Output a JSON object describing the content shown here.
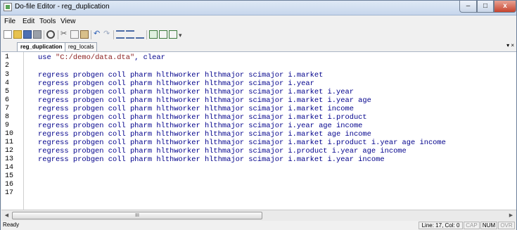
{
  "window": {
    "title": "Do-file Editor - reg_duplication"
  },
  "menu": [
    "File",
    "Edit",
    "Tools",
    "View"
  ],
  "toolbar_icons": [
    "new-file-icon",
    "open-icon",
    "save-icon",
    "print-icon",
    "find-icon",
    "cut-icon",
    "copy-icon",
    "paste-icon",
    "undo-icon",
    "redo-icon",
    "indent-icon",
    "unindent-icon",
    "comment-icon",
    "execute-icon",
    "execute-quietly-icon",
    "execute-selection-icon",
    "dropdown-icon"
  ],
  "tabs": [
    {
      "label": "reg_duplication",
      "active": true
    },
    {
      "label": "reg_locals",
      "active": false
    }
  ],
  "editor": {
    "lines": [
      {
        "num": "1",
        "text": "use ",
        "str": "\"C:/demo/data.dta\"",
        "rest": ", clear"
      },
      {
        "num": "2",
        "text": ""
      },
      {
        "num": "3",
        "text": "regress probgen coll pharm hlthworker hlthmajor scimajor i.market"
      },
      {
        "num": "4",
        "text": "regress probgen coll pharm hlthworker hlthmajor scimajor i.year"
      },
      {
        "num": "5",
        "text": "regress probgen coll pharm hlthworker hlthmajor scimajor i.market i.year"
      },
      {
        "num": "6",
        "text": "regress probgen coll pharm hlthworker hlthmajor scimajor i.market i.year age"
      },
      {
        "num": "7",
        "text": "regress probgen coll pharm hlthworker hlthmajor scimajor i.market income"
      },
      {
        "num": "8",
        "text": "regress probgen coll pharm hlthworker hlthmajor scimajor i.market i.product"
      },
      {
        "num": "9",
        "text": "regress probgen coll pharm hlthworker hlthmajor scimajor i.year age income"
      },
      {
        "num": "10",
        "text": "regress probgen coll pharm hlthworker hlthmajor scimajor i.market age income"
      },
      {
        "num": "11",
        "text": "regress probgen coll pharm hlthworker hlthmajor scimajor i.market i.product i.year age income"
      },
      {
        "num": "12",
        "text": "regress probgen coll pharm hlthworker hlthmajor scimajor i.product i.year age income"
      },
      {
        "num": "13",
        "text": "regress probgen coll pharm hlthworker hlthmajor scimajor i.market i.year income"
      },
      {
        "num": "14",
        "text": ""
      },
      {
        "num": "15",
        "text": ""
      },
      {
        "num": "16",
        "text": ""
      },
      {
        "num": "17",
        "text": ""
      }
    ]
  },
  "scrollbar": {
    "thumb_grip": "III"
  },
  "status": {
    "ready": "Ready",
    "position": "Line: 17, Col: 0",
    "cap": "CAP",
    "num": "NUM",
    "ovr": "OVR"
  }
}
